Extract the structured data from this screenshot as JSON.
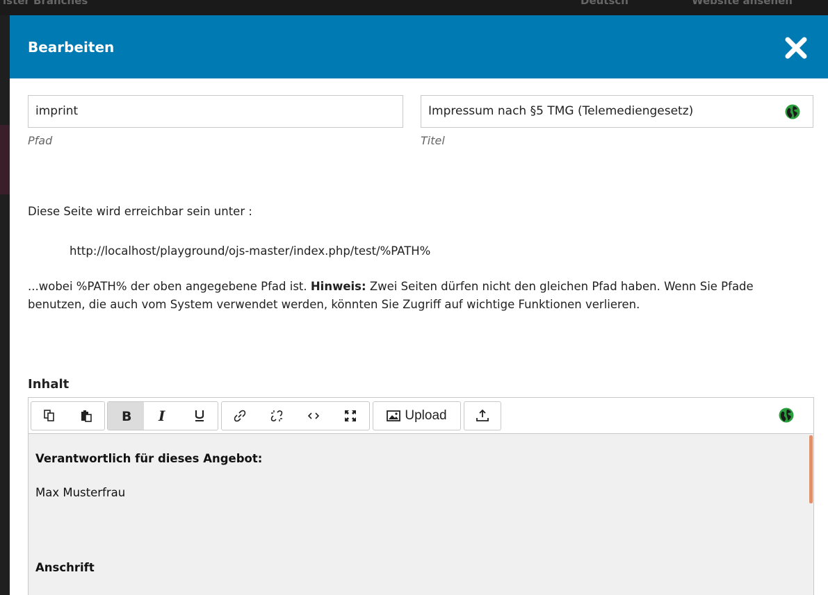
{
  "background": {
    "left_text": "ister Branches",
    "lang_text": "Deutsch",
    "site_text": "Website ansehen"
  },
  "modal": {
    "title": "Bearbeiten",
    "header_color": "#007ab2",
    "close_icon": "close-icon"
  },
  "form": {
    "path": {
      "value": "imprint",
      "label": "Pfad"
    },
    "title": {
      "value": "Impressum nach §5 TMG (Telemediengesetz)",
      "label": "Titel",
      "icon": "globe-icon"
    }
  },
  "info": {
    "line1": "Diese Seite wird erreichbar sein unter :",
    "url": "http://localhost/playground/ojs-master/index.php/test/%PATH%",
    "note_pre": "...wobei %PATH% der oben angegebene Pfad ist.",
    "note_bold": "Hinweis:",
    "note_post": "Zwei Seiten dürfen nicht den gleichen Pfad haben. Wenn Sie Pfade benutzen, die auch vom System verwendet werden, könnten Sie Zugriff auf wichtige Funktionen verlieren."
  },
  "content": {
    "label": "Inhalt",
    "toolbar": {
      "buttons": [
        "copy",
        "paste",
        "bold",
        "italic",
        "underline",
        "link",
        "unlink",
        "code",
        "fullscreen",
        "image",
        "upload-file"
      ],
      "upload_label": "Upload",
      "active": "bold"
    },
    "body": {
      "heading1": "Verantwortlich für dieses Angebot:",
      "name": "Max Musterfrau",
      "heading2": "Anschrift"
    },
    "scrollbar_color": "#e0906a"
  }
}
